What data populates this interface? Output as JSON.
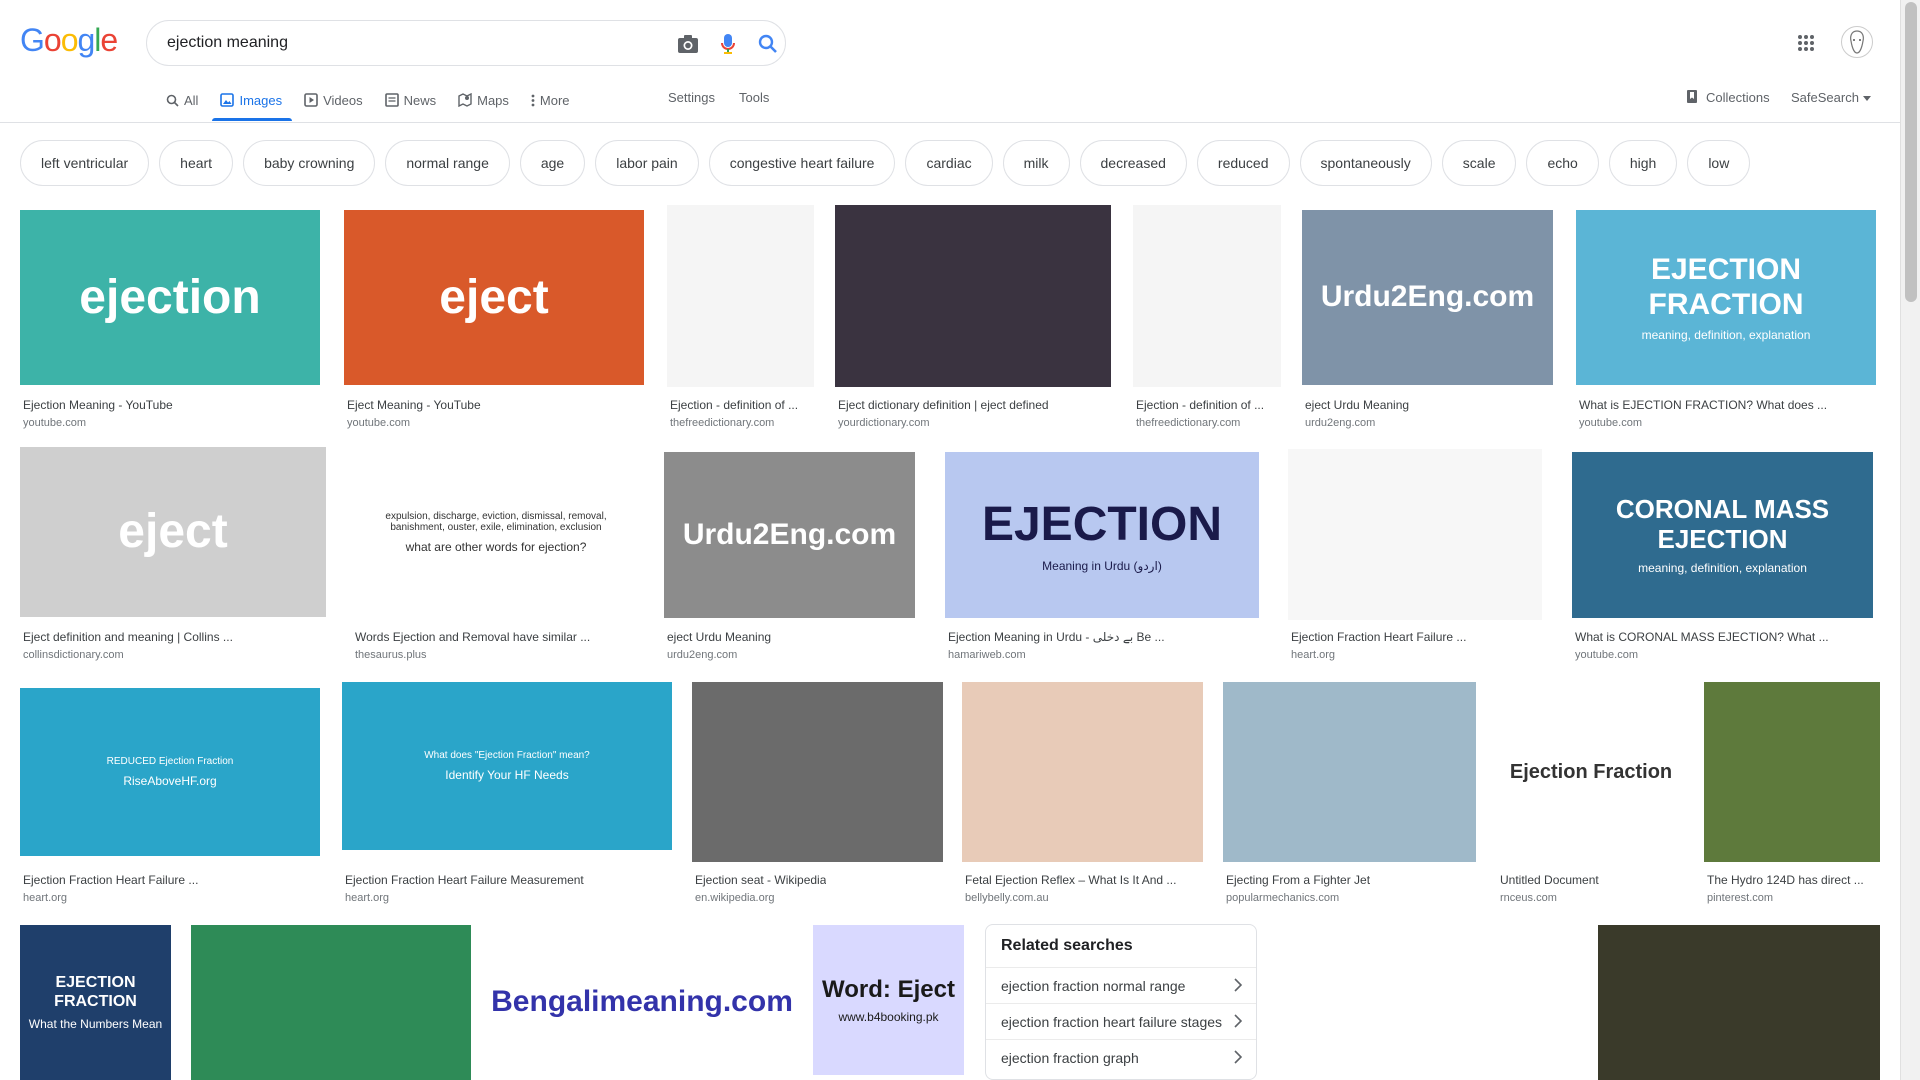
{
  "logo": {
    "letters": [
      "G",
      "o",
      "o",
      "g",
      "l",
      "e"
    ],
    "colors": [
      "#4285F4",
      "#EA4335",
      "#FBBC05",
      "#4285F4",
      "#34A853",
      "#EA4335"
    ]
  },
  "search": {
    "query": "ejection meaning"
  },
  "tabs": [
    {
      "label": "All",
      "icon": "search-icon"
    },
    {
      "label": "Images",
      "icon": "image-icon",
      "active": true
    },
    {
      "label": "Videos",
      "icon": "video-icon"
    },
    {
      "label": "News",
      "icon": "news-icon"
    },
    {
      "label": "Maps",
      "icon": "map-icon"
    },
    {
      "label": "More",
      "icon": "more-vertical-icon"
    }
  ],
  "tools": {
    "settings": "Settings",
    "tools": "Tools"
  },
  "collections_label": "Collections",
  "safesearch_label": "SafeSearch",
  "chips": [
    "left ventricular",
    "heart",
    "baby crowning",
    "normal range",
    "age",
    "labor pain",
    "congestive heart failure",
    "cardiac",
    "milk",
    "decreased",
    "reduced",
    "spontaneously",
    "scale",
    "echo",
    "high",
    "low"
  ],
  "images": [
    {
      "title": "Ejection Meaning - YouTube",
      "source": "youtube.com",
      "text": "ejection",
      "bg": "#3db3a8",
      "fg": "#ffffff"
    },
    {
      "title": "Eject Meaning - YouTube",
      "source": "youtube.com",
      "text": "eject",
      "bg": "#d9592a",
      "fg": "#ffffff"
    },
    {
      "title": "Ejection - definition of ...",
      "source": "thefreedictionary.com",
      "text": "",
      "bg": "#f5f5f5",
      "fg": "#333"
    },
    {
      "title": "Eject dictionary definition | eject defined",
      "source": "yourdictionary.com",
      "text": "",
      "bg": "#3a3340",
      "fg": "#fff"
    },
    {
      "title": "Ejection - definition of ...",
      "source": "thefreedictionary.com",
      "text": "",
      "bg": "#f5f5f5",
      "fg": "#333"
    },
    {
      "title": "eject Urdu Meaning",
      "source": "urdu2eng.com",
      "text": "Urdu2Eng.com",
      "bg": "#7f93a8",
      "fg": "#ffffff"
    },
    {
      "title": "What is EJECTION FRACTION? What does ...",
      "source": "youtube.com",
      "text": "EJECTION FRACTION",
      "sub": "meaning, definition, explanation",
      "bg": "#5bb5d6",
      "fg": "#ffffff"
    },
    {
      "title": "Eject definition and meaning | Collins ...",
      "source": "collinsdictionary.com",
      "text": "eject",
      "bg": "#cfcfcf",
      "fg": "#ffffff"
    },
    {
      "title": "Words Ejection and Removal have similar ...",
      "source": "thesaurus.plus",
      "text": "expulsion, discharge, eviction, dismissal, removal, banishment, ouster, exile, elimination, exclusion",
      "sub": "what are other words for ejection?",
      "bg": "#ffffff",
      "fg": "#333"
    },
    {
      "title": "eject Urdu Meaning",
      "source": "urdu2eng.com",
      "text": "Urdu2Eng.com",
      "bg": "#8c8c8c",
      "fg": "#ffffff"
    },
    {
      "title": "Ejection Meaning in Urdu - بے دخلی Be ...",
      "source": "hamariweb.com",
      "text": "EJECTION",
      "sub": "Meaning in Urdu (اردو)",
      "bg": "#b8c8f0",
      "fg": "#1a1a4a"
    },
    {
      "title": "Ejection Fraction Heart Failure ...",
      "source": "heart.org",
      "text": "",
      "bg": "#f7f7f7",
      "fg": "#333"
    },
    {
      "title": "What is CORONAL MASS EJECTION? What ...",
      "source": "youtube.com",
      "text": "CORONAL MASS EJECTION",
      "sub": "meaning, definition, explanation",
      "bg": "#2f6b8f",
      "fg": "#ffffff"
    },
    {
      "title": "Ejection Fraction Heart Failure ...",
      "source": "heart.org",
      "text": "REDUCED Ejection Fraction",
      "sub": "RiseAboveHF.org",
      "bg": "#2aa5c9",
      "fg": "#ffffff"
    },
    {
      "title": "Ejection Fraction Heart Failure Measurement",
      "source": "heart.org",
      "text": "What does \"Ejection Fraction\" mean?",
      "sub": "Identify Your HF Needs",
      "bg": "#2aa5c9",
      "fg": "#ffffff"
    },
    {
      "title": "Ejection seat - Wikipedia",
      "source": "en.wikipedia.org",
      "text": "",
      "bg": "#6b6b6b",
      "fg": "#fff"
    },
    {
      "title": "Fetal Ejection Reflex – What Is It And ...",
      "source": "bellybelly.com.au",
      "text": "",
      "bg": "#e8cbb8",
      "fg": "#fff"
    },
    {
      "title": "Ejecting From a Fighter Jet",
      "source": "popularmechanics.com",
      "text": "",
      "bg": "#9fb9c9",
      "fg": "#fff"
    },
    {
      "title": "Untitled Document",
      "source": "rnceus.com",
      "text": "Ejection Fraction",
      "bg": "#ffffff",
      "fg": "#333"
    },
    {
      "title": "The Hydro 124D has direct ...",
      "source": "pinterest.com",
      "text": "",
      "bg": "#5e7a3c",
      "fg": "#fff"
    },
    {
      "title": "",
      "source": "",
      "text": "EJECTION FRACTION",
      "sub": "What the Numbers Mean",
      "bg": "#1f3f6b",
      "fg": "#ffffff"
    },
    {
      "title": "",
      "source": "",
      "text": "",
      "bg": "#2e8b57",
      "fg": "#fff"
    },
    {
      "title": "",
      "source": "",
      "text": "Bengalimeaning.com",
      "bg": "#ffffff",
      "fg": "#3333aa"
    },
    {
      "title": "",
      "source": "",
      "text": "Word: Eject",
      "sub": "www.b4booking.pk",
      "bg": "#d9d9ff",
      "fg": "#1a1a1a"
    },
    {
      "title": "",
      "source": "",
      "text": "",
      "bg": "#ffffff",
      "fg": "#4a6fd0"
    },
    {
      "title": "",
      "source": "",
      "text": "",
      "bg": "#3a3a2a",
      "fg": "#fff"
    }
  ],
  "related": {
    "title": "Related searches",
    "items": [
      "ejection fraction normal range",
      "ejection fraction heart failure stages",
      "ejection fraction graph"
    ]
  },
  "colors": {
    "accent": "#1a73e8",
    "border": "#dfe1e5"
  }
}
